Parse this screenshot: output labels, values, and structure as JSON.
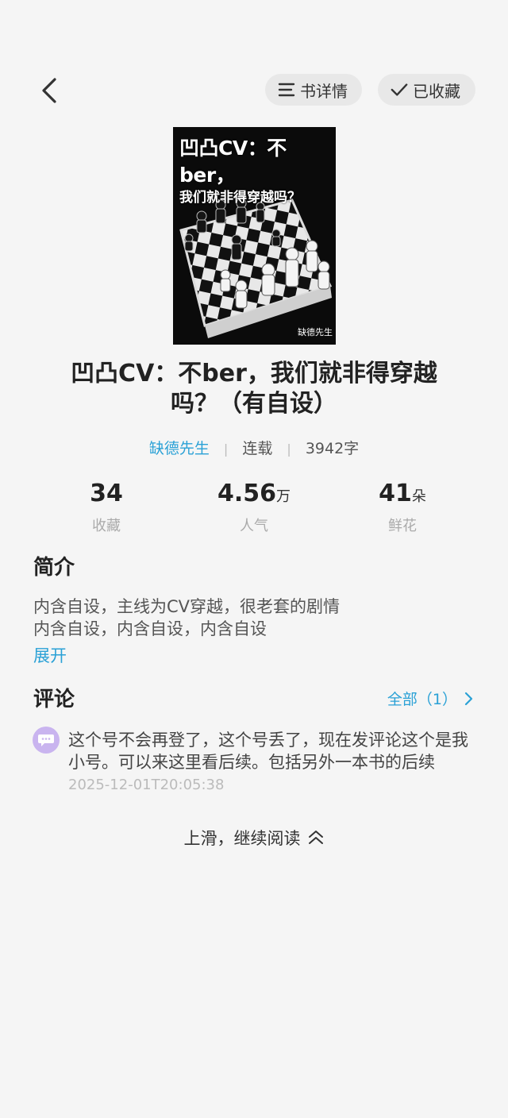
{
  "header": {
    "detail_label": "书详情",
    "fav_label": "已收藏"
  },
  "cover": {
    "title_line1": "凹凸CV：不ber，",
    "title_line2": "我们就非得穿越吗？",
    "author_mark": "缺德先生"
  },
  "book": {
    "title": "凹凸CV：不ber，我们就非得穿越吗？（有自设）",
    "author": "缺德先生",
    "status": "连载",
    "word_count": "3942字"
  },
  "stats": [
    {
      "value": "34",
      "unit": "",
      "label": "收藏"
    },
    {
      "value": "4.56",
      "unit": "万",
      "label": "人气"
    },
    {
      "value": "41",
      "unit": "朵",
      "label": "鲜花"
    }
  ],
  "intro": {
    "heading": "简介",
    "line1": "内含自设，主线为CV穿越，很老套的剧情",
    "line2": "内含自设，内含自设，内含自设",
    "expand": "展开"
  },
  "comments": {
    "heading": "评论",
    "all_label": "全部（1）",
    "items": [
      {
        "text": "这个号不会再登了，这个号丢了，现在发评论这个是我小号。可以来这里看后续。包括另外一本书的后续",
        "time": "2025-12-01T20:05:38"
      }
    ]
  },
  "footer": {
    "continue_label": "上滑，继续阅读"
  }
}
